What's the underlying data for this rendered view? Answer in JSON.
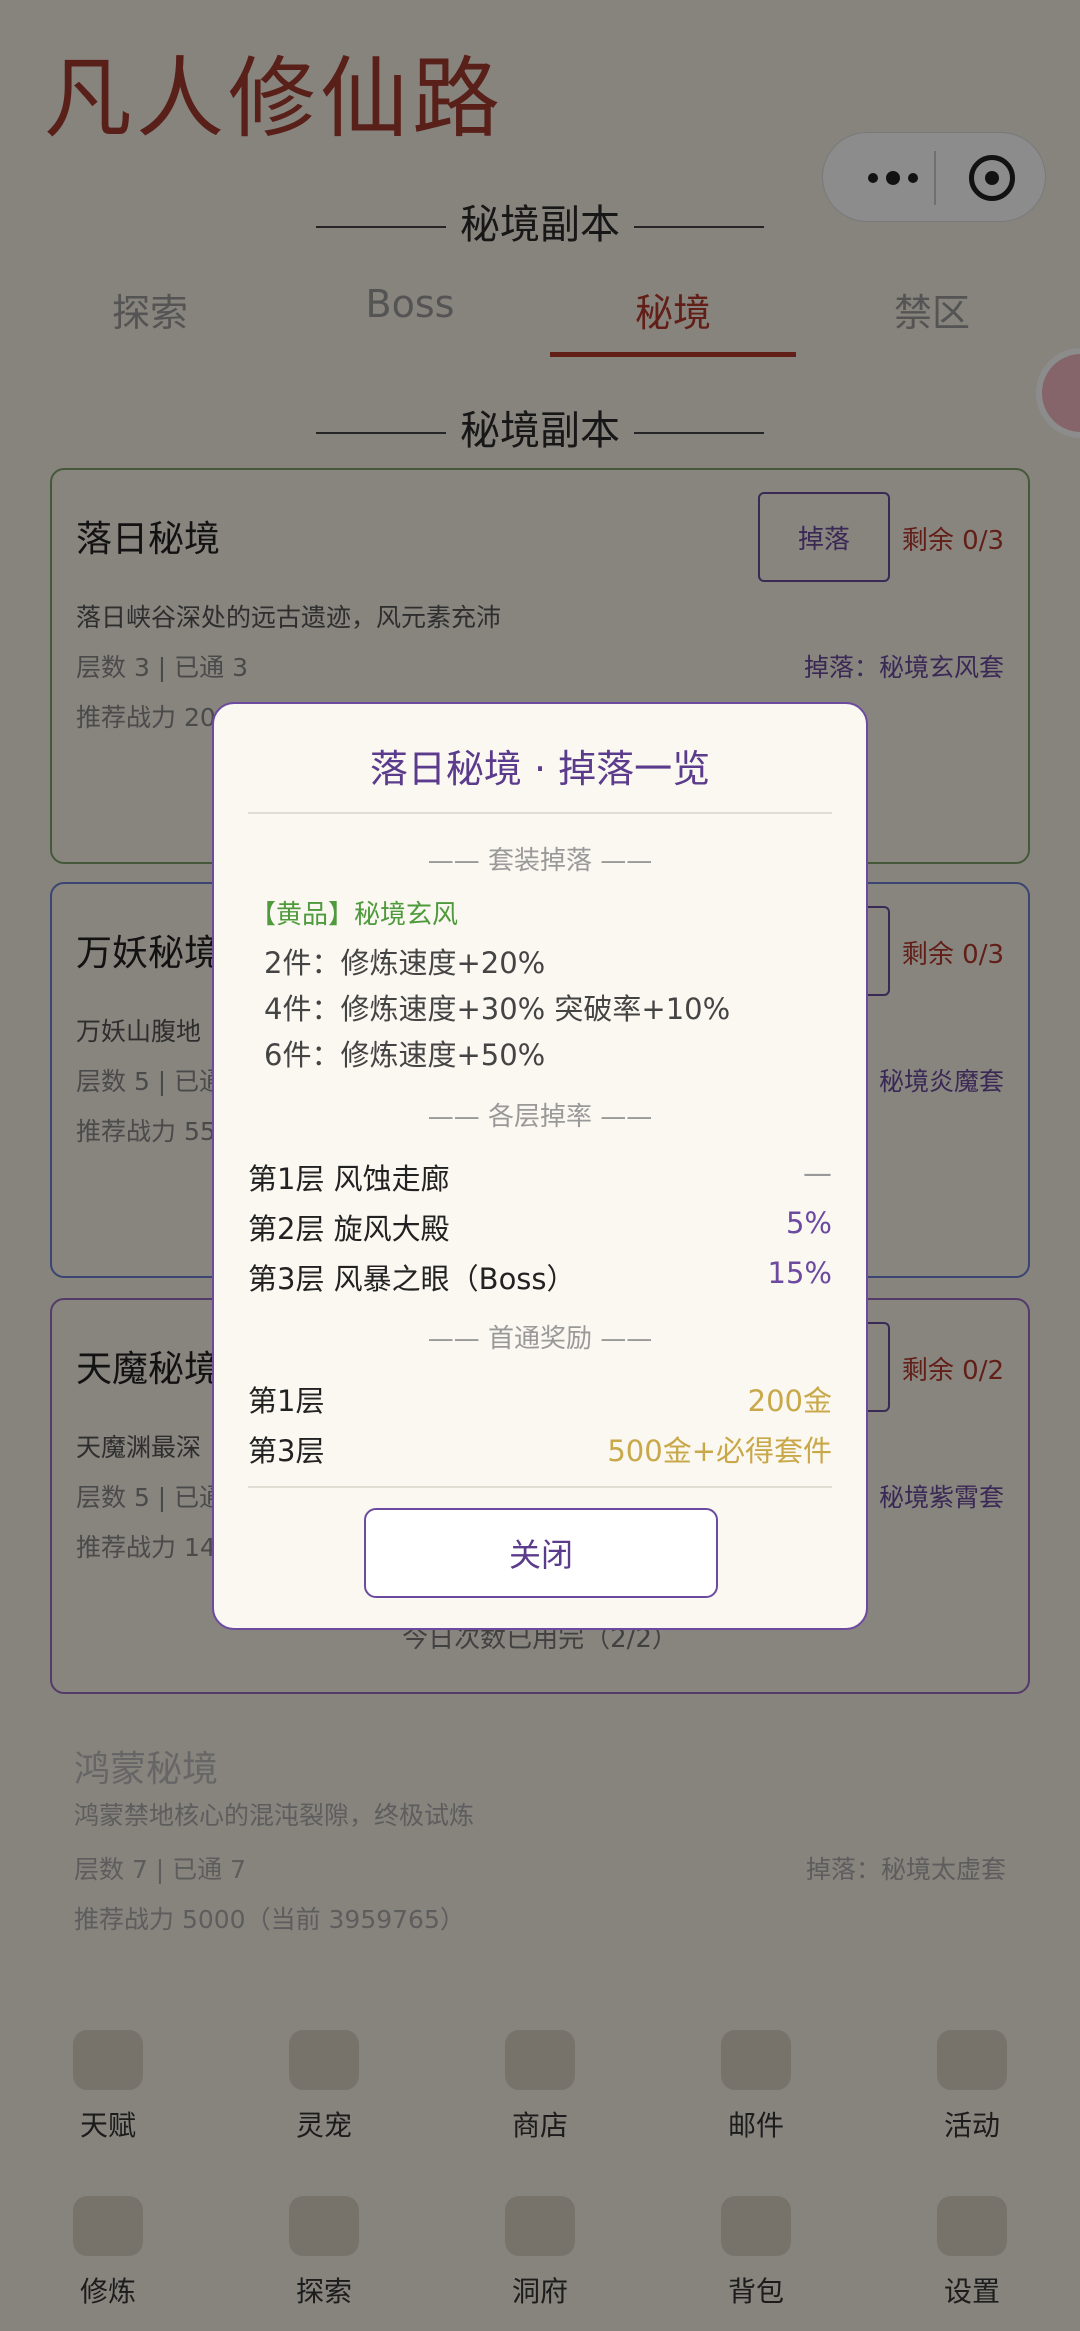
{
  "app": {
    "title": "凡人修仙路"
  },
  "header": {
    "section_title": "秘境副本"
  },
  "tabs": [
    {
      "label": "探索"
    },
    {
      "label": "Boss"
    },
    {
      "label": "秘境"
    },
    {
      "label": "禁区"
    }
  ],
  "list_title": "秘境副本",
  "cards": [
    {
      "name": "落日秘境",
      "drop_button": "掉落",
      "remain": "剩余 0/3",
      "desc": "落日峡谷深处的远古遗迹，风元素充沛",
      "floor": "层数 3 | 已通 3",
      "drop_set": "掉落：秘境玄风套",
      "power": "推荐战力 20"
    },
    {
      "name": "万妖秘境",
      "drop_button": "掉落",
      "remain": "剩余 0/3",
      "desc": "万妖山腹地",
      "floor": "层数 5 | 已通",
      "drop_set": "秘境炎魔套",
      "power": "推荐战力 55"
    },
    {
      "name": "天魔秘境",
      "drop_button": "掉落",
      "remain": "剩余 0/2",
      "desc": "天魔渊最深",
      "floor": "层数 5 | 已通",
      "drop_set": "秘境紫霄套",
      "power": "推荐战力 14",
      "exhausted": "今日次数已用完（2/2）"
    },
    {
      "name": "鸿蒙秘境",
      "desc": "鸿蒙禁地核心的混沌裂隙，终极试炼",
      "floor": "层数 7 | 已通 7",
      "drop_set": "掉落：秘境太虚套",
      "power": "推荐战力 5000（当前 3959765）"
    }
  ],
  "bottom_nav": {
    "row1": [
      {
        "label": "天赋",
        "icon": "scroll-icon"
      },
      {
        "label": "灵宠",
        "icon": "pet-icon"
      },
      {
        "label": "商店",
        "icon": "shop-icon"
      },
      {
        "label": "邮件",
        "icon": "mail-icon"
      },
      {
        "label": "活动",
        "icon": "lantern-icon"
      }
    ],
    "row2": [
      {
        "label": "修炼",
        "icon": "meditation-icon"
      },
      {
        "label": "探索",
        "icon": "mountain-icon"
      },
      {
        "label": "洞府",
        "icon": "cave-icon"
      },
      {
        "label": "背包",
        "icon": "bag-icon"
      },
      {
        "label": "设置",
        "icon": "gear-icon"
      }
    ]
  },
  "modal": {
    "title": "落日秘境 · 掉落一览",
    "set_section": "—— 套装掉落 ——",
    "set_name": "【黄品】秘境玄风",
    "bonuses": [
      "2件：修炼速度+20%",
      "4件：修炼速度+30% 突破率+10%",
      "6件：修炼速度+50%"
    ],
    "floor_section": "—— 各层掉率 ——",
    "floors": [
      {
        "name": "第1层 风蚀走廊",
        "rate": "—"
      },
      {
        "name": "第2层 旋风大殿",
        "rate": "5%"
      },
      {
        "name": "第3层 风暴之眼（Boss）",
        "rate": "15%"
      }
    ],
    "first_clear_section": "—— 首通奖励 ——",
    "first_clear": [
      {
        "name": "第1层",
        "reward": "200金"
      },
      {
        "name": "第3层",
        "reward": "500金+必得套件"
      }
    ],
    "close_label": "关闭"
  },
  "colors": {
    "accent_red": "#b33a2c",
    "accent_purple": "#6b4aa0",
    "gold": "#c9a84a",
    "green": "#4e9a3c"
  }
}
